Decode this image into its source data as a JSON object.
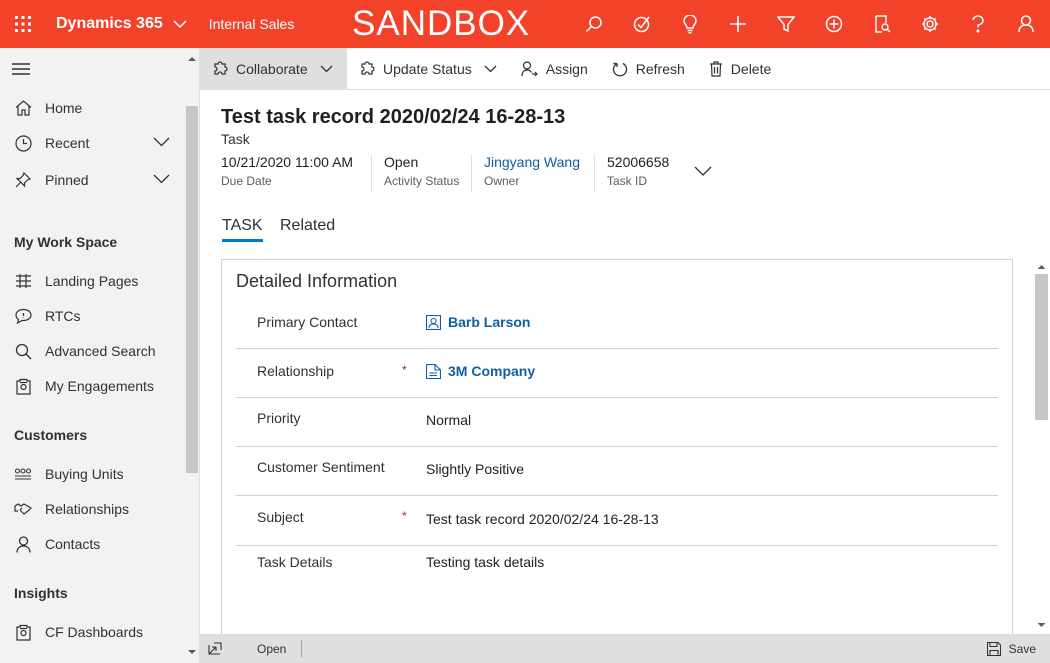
{
  "topbar": {
    "app_name": "Dynamics 365",
    "area_name": "Internal Sales",
    "environment_label": "SANDBOX",
    "background_color": "#f2432a",
    "icons": [
      "search-icon",
      "task-check-icon",
      "lightbulb-icon",
      "plus-icon",
      "filter-icon",
      "circle-plus-icon",
      "report-search-icon",
      "gear-icon",
      "help-icon",
      "user-icon"
    ]
  },
  "sidebar": {
    "items": [
      {
        "label": "Home",
        "icon": "home-icon"
      },
      {
        "label": "Recent",
        "icon": "clock-icon"
      },
      {
        "label": "Pinned",
        "icon": "pin-icon"
      }
    ],
    "groups": [
      {
        "title": "My Work Space",
        "items": [
          {
            "label": "Landing Pages",
            "icon": "landing-pages-icon"
          },
          {
            "label": "RTCs",
            "icon": "chat-icon"
          },
          {
            "label": "Advanced Search",
            "icon": "search-icon"
          },
          {
            "label": "My Engagements",
            "icon": "clipboard-icon"
          }
        ]
      },
      {
        "title": "Customers",
        "items": [
          {
            "label": "Buying Units",
            "icon": "buying-units-icon"
          },
          {
            "label": "Relationships",
            "icon": "handshake-icon"
          },
          {
            "label": "Contacts",
            "icon": "person-icon"
          }
        ]
      },
      {
        "title": "Insights",
        "items": [
          {
            "label": "CF Dashboards",
            "icon": "dashboard-icon"
          }
        ]
      }
    ]
  },
  "commandbar": {
    "collaborate": "Collaborate",
    "update_status": "Update Status",
    "assign": "Assign",
    "refresh": "Refresh",
    "delete": "Delete"
  },
  "record": {
    "title": "Test task record 2020/02/24 16-28-13",
    "entity": "Task",
    "header_fields": [
      {
        "value": "10/21/2020 11:00 AM",
        "label": "Due Date"
      },
      {
        "value": "Open",
        "label": "Activity Status"
      },
      {
        "value": "Jingyang Wang",
        "label": "Owner"
      },
      {
        "value": "52006658",
        "label": "Task ID"
      }
    ]
  },
  "tabs": [
    {
      "label": "TASK",
      "selected": true
    },
    {
      "label": "Related",
      "selected": false
    }
  ],
  "section": {
    "title": "Detailed Information",
    "fields": [
      {
        "label": "Primary Contact",
        "value": "Barb Larson",
        "required": false,
        "is_lookup": true,
        "icon": "contact-card-icon"
      },
      {
        "label": "Relationship",
        "value": "3M Company",
        "required": true,
        "is_lookup": true,
        "icon": "account-icon"
      },
      {
        "label": "Priority",
        "value": "Normal",
        "required": false,
        "is_lookup": false
      },
      {
        "label": "Customer Sentiment",
        "value": "Slightly Positive",
        "required": false,
        "is_lookup": false
      },
      {
        "label": "Subject",
        "value": "Test task record 2020/02/24 16-28-13",
        "required": true,
        "is_lookup": false
      },
      {
        "label": "Task Details",
        "value": "Testing task details",
        "required": false,
        "is_lookup": false
      }
    ],
    "required_marker": "*"
  },
  "footer": {
    "status": "Open",
    "save_label": "Save"
  },
  "colors": {
    "accent": "#0078d4",
    "link": "#115ea3",
    "required": "#a4262c"
  }
}
